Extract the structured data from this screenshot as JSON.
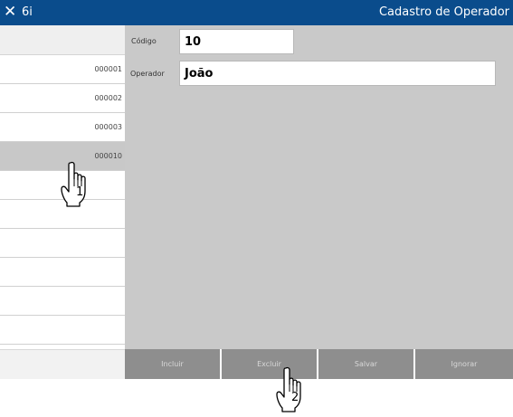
{
  "titlebar": {
    "close_glyph": "✕",
    "app_name": "6i",
    "window_title": "Cadastro de Operador"
  },
  "list": {
    "rows": [
      {
        "code": "000001"
      },
      {
        "code": "000002"
      },
      {
        "code": "000003"
      },
      {
        "code": "000010",
        "selected": true
      },
      {
        "code": ""
      },
      {
        "code": ""
      },
      {
        "code": ""
      },
      {
        "code": ""
      },
      {
        "code": ""
      },
      {
        "code": ""
      }
    ]
  },
  "form": {
    "codigo_label": "Código",
    "codigo_value": "10",
    "operador_label": "Operador",
    "operador_value": "João"
  },
  "buttons": {
    "incluir": "Incluir",
    "excluir": "Excluir",
    "salvar": "Salvar",
    "ignorar": "Ignorar"
  },
  "annotations": {
    "step1": "1",
    "step2": "2"
  },
  "colors": {
    "titlebar": "#0a4c8c",
    "panel": "#c9c9c9",
    "button": "#8e8e8e",
    "selected_row": "#c8c8c8"
  },
  "icons": [
    "close-icon",
    "hand-pointer-icon"
  ]
}
